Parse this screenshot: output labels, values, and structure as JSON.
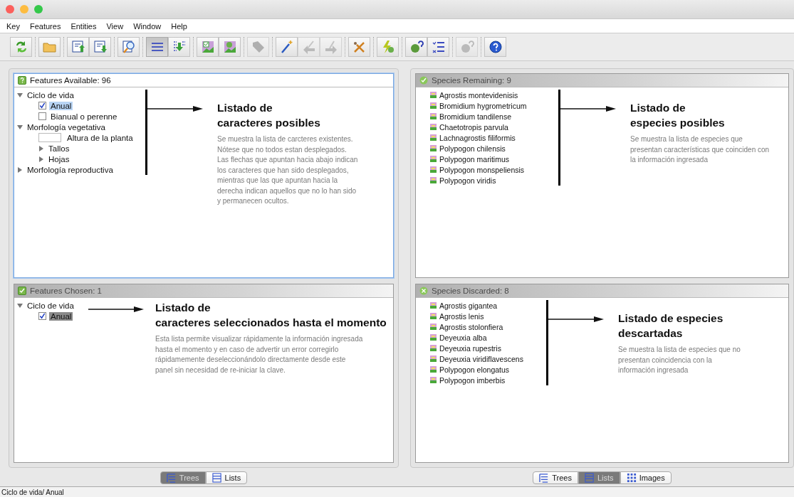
{
  "menu": [
    "Key",
    "Features",
    "Entities",
    "View",
    "Window",
    "Help"
  ],
  "toolbar": [
    {
      "buttons": [
        {
          "kind": "refresh",
          "selected": false,
          "disabled": false
        }
      ]
    },
    {
      "buttons": [
        {
          "kind": "folder",
          "selected": false,
          "disabled": false
        }
      ]
    },
    {
      "buttons": [
        {
          "kind": "export",
          "selected": false,
          "disabled": false
        },
        {
          "kind": "import",
          "selected": false,
          "disabled": false
        }
      ]
    },
    {
      "buttons": [
        {
          "kind": "search",
          "selected": false,
          "disabled": false
        }
      ]
    },
    {
      "buttons": [
        {
          "kind": "list",
          "selected": true,
          "disabled": false
        },
        {
          "kind": "listdown",
          "selected": false,
          "disabled": false
        }
      ]
    },
    {
      "buttons": [
        {
          "kind": "imagecheck",
          "selected": false,
          "disabled": false
        },
        {
          "kind": "imageok",
          "selected": false,
          "disabled": false
        }
      ]
    },
    {
      "buttons": [
        {
          "kind": "tag",
          "selected": false,
          "disabled": true
        }
      ]
    },
    {
      "buttons": [
        {
          "kind": "wand",
          "selected": false,
          "disabled": false
        },
        {
          "kind": "back",
          "selected": false,
          "disabled": true
        },
        {
          "kind": "forward",
          "selected": false,
          "disabled": true
        }
      ]
    },
    {
      "buttons": [
        {
          "kind": "scissors",
          "selected": false,
          "disabled": false
        }
      ]
    },
    {
      "buttons": [
        {
          "kind": "lightning",
          "selected": false,
          "disabled": false
        }
      ]
    },
    {
      "buttons": [
        {
          "kind": "helpball",
          "selected": false,
          "disabled": false
        },
        {
          "kind": "checklist",
          "selected": false,
          "disabled": false
        }
      ]
    },
    {
      "buttons": [
        {
          "kind": "helpball",
          "selected": false,
          "disabled": true
        }
      ]
    },
    {
      "buttons": [
        {
          "kind": "help",
          "selected": false,
          "disabled": false
        }
      ]
    }
  ],
  "columns": [
    {
      "panels": [
        {
          "title": "Features Available: 96",
          "active": true,
          "kind": "tree",
          "pointer": {
            "kind": "bracket"
          },
          "nodes": [
            {
              "label": "Ciclo de vida",
              "kind": "branch",
              "expanded": true,
              "children": [
                {
                  "label": "Anual",
                  "kind": "check",
                  "checked": true,
                  "selected": true
                },
                {
                  "label": "Bianual o perenne",
                  "kind": "check",
                  "checked": false,
                  "selected": false
                }
              ]
            },
            {
              "label": "Morfología vegetativa",
              "kind": "branch",
              "expanded": true,
              "children": [
                {
                  "label": "Altura de la planta",
                  "kind": "field"
                },
                {
                  "label": "Tallos",
                  "kind": "branch",
                  "expanded": false
                },
                {
                  "label": "Hojas",
                  "kind": "branch",
                  "expanded": false
                }
              ]
            },
            {
              "label": "Morfología reproductiva",
              "kind": "branch",
              "expanded": false
            }
          ],
          "note": {
            "title": [
              "Listado de",
              "caracteres posibles"
            ],
            "text": [
              "Se muestra la lista de carcteres existentes.",
              "Nótese que no todos estan desplegados.",
              "Las flechas que apuntan hacia abajo indican",
              "los caracteres que han sido desplegados,",
              "mientras que las que apuntan hacia la",
              "derecha indican aquellos que no lo han sido",
              "y permanecen ocultos."
            ]
          }
        },
        {
          "title": "Features Chosen: 1",
          "active": false,
          "kind": "tree",
          "pointer": {
            "kind": "arrow"
          },
          "nodes": [
            {
              "label": "Ciclo de vida",
              "kind": "branch",
              "expanded": true,
              "children": [
                {
                  "label": "Anual",
                  "kind": "check",
                  "checked": true,
                  "selected": true
                }
              ]
            }
          ],
          "note": {
            "title": [
              "Listado de",
              "caracteres seleccionados hasta el momento"
            ],
            "text": [
              "Esta lista permite visualizar rápidamente la información ingresada",
              "hasta el momento y en caso de advertir un error corregirlo",
              "rápidamemente deseleccionándolo directamente desde este",
              "panel sin necesidad de re-iniciar la clave."
            ]
          }
        }
      ],
      "tabs": [
        {
          "label": "Trees",
          "kind": "tree",
          "selected": true
        },
        {
          "label": "Lists",
          "kind": "list",
          "selected": false
        }
      ]
    },
    {
      "panels": [
        {
          "title": "Species Remaining: 9",
          "active": false,
          "kind": "list",
          "pointer": {
            "kind": "bracket"
          },
          "items": [
            "Agrostis montevidenisis",
            "Bromidium hygrometricum",
            "Bromidium tandilense",
            "Chaetotropis parvula",
            "Lachnagrostis filiformis",
            "Polypogon chilensis",
            "Polypogon maritimus",
            "Polypogon monspeliensis",
            "Polypogon viridis"
          ],
          "note": {
            "title": [
              "Listado de",
              "especies posibles"
            ],
            "text": [
              "Se muestra la lista de especies que",
              "presentan características que coinciden con",
              "la información ingresada"
            ]
          }
        },
        {
          "title": "Species Discarded: 8",
          "active": false,
          "kind": "list",
          "pointer": {
            "kind": "bracket"
          },
          "items": [
            "Agrostis gigantea",
            "Agrostis lenis",
            "Agrostis stolonfiera",
            "Deyeuxia alba",
            "Deyeuxia rupestris",
            "Deyeuxia viridiflavescens",
            "Polypogon elongatus",
            "Polypogon imberbis"
          ],
          "note": {
            "title": [
              "Listado de especies",
              "descartadas"
            ],
            "text": [
              "Se muestra la lista de especies que no",
              "presentan coincidencia con la",
              "información ingresada"
            ]
          }
        }
      ],
      "tabs": [
        {
          "label": "Trees",
          "kind": "tree",
          "selected": false
        },
        {
          "label": "Lists",
          "kind": "list",
          "selected": true
        },
        {
          "label": "Images",
          "kind": "grid",
          "selected": false
        }
      ]
    }
  ],
  "status_bar": "Ciclo de vida/ Anual"
}
